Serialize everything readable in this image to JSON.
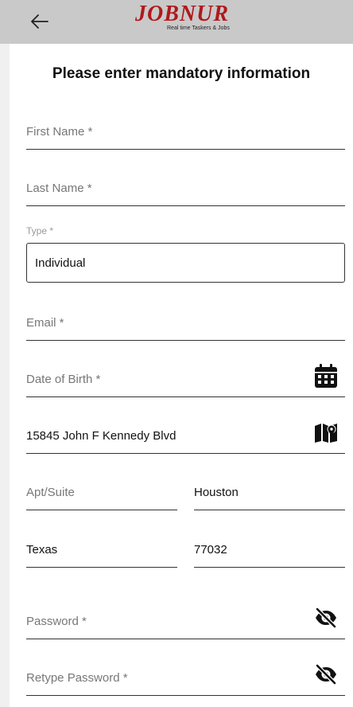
{
  "header": {
    "back_icon": "back-arrow-icon",
    "logo_text": "JOBNUR",
    "logo_tagline": "Real time Taskers & Jobs",
    "brand_color": "#b0191c"
  },
  "form": {
    "title": "Please enter mandatory information",
    "first_name_placeholder": "First Name *",
    "last_name_placeholder": "Last Name *",
    "type_label": "Type *",
    "type_value": "Individual",
    "email_placeholder": "Email *",
    "dob_placeholder": "Date of Birth *",
    "dob_icon": "calendar-icon",
    "address_value": "15845 John F Kennedy Blvd",
    "address_icon": "map-icon",
    "apt_placeholder": "Apt/Suite",
    "city_value": "Houston",
    "state_value": "Texas",
    "zip_value": "77032",
    "password_placeholder": "Password *",
    "password_icon": "eye-slash-icon",
    "retype_password_placeholder": "Retype Password *",
    "retype_password_icon": "eye-slash-icon"
  }
}
